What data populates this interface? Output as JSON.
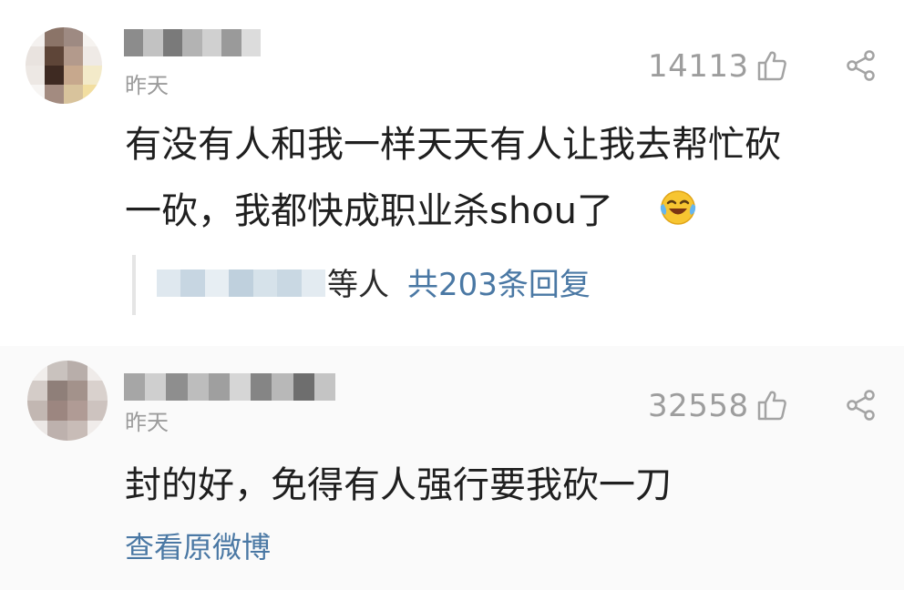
{
  "comments": [
    {
      "time": "昨天",
      "likes": "14113",
      "content_lines": [
        "有没有人和我一样天天有人让我去帮忙砍",
        "一砍，我都快成职业杀shou了"
      ],
      "emoji": "laughing-crying-emoji",
      "replies": {
        "suffix": "等人",
        "count_link": "共203条回复"
      }
    },
    {
      "time": "昨天",
      "likes": "32558",
      "content_lines": [
        "封的好，免得有人强行要我砍一刀"
      ],
      "view_original": "查看原微博"
    }
  ],
  "colors": {
    "link_blue": "#4a78a4",
    "meta_gray": "#9b9b9b",
    "text_dark": "#1f1f1f"
  },
  "icons": [
    "thumbs-up-icon",
    "share-icon",
    "laughing-crying-emoji"
  ]
}
